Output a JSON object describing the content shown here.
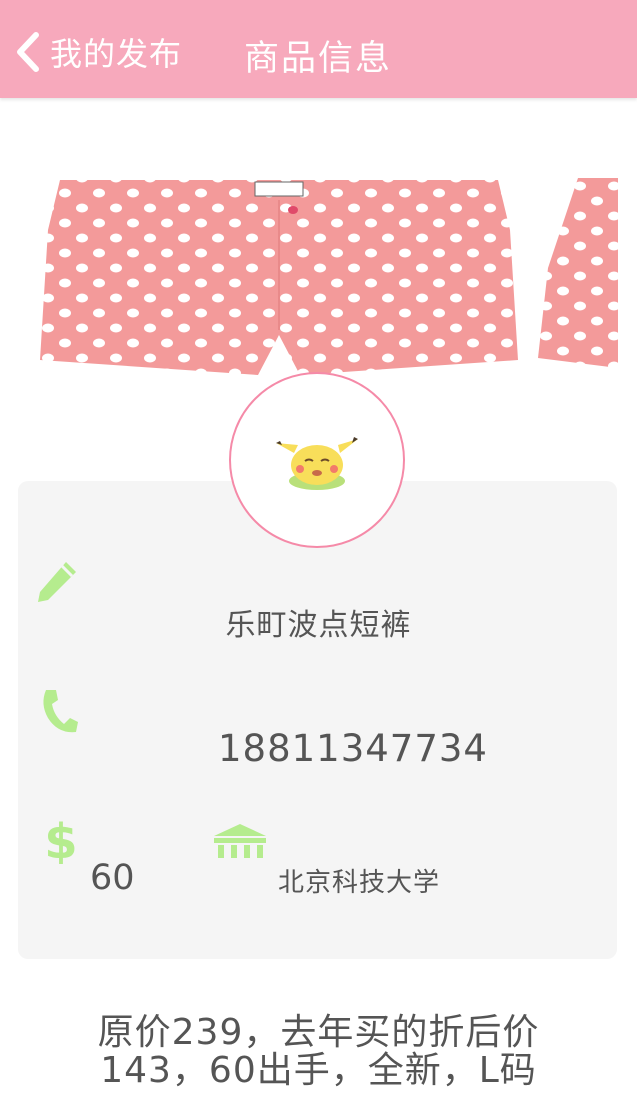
{
  "header": {
    "back_label": "我的发布",
    "title": "商品信息"
  },
  "product": {
    "name": "乐町波点短裤",
    "phone": "18811347734",
    "price": "60",
    "school": "北京科技大学",
    "description_line1": "原价239，去年买的折后价",
    "description_line2": "143，60出手，全新，L码"
  },
  "icons": {
    "back": "chevron-left-icon",
    "name": "pencil-icon",
    "phone": "phone-icon",
    "price": "dollar-icon",
    "school": "school-building-icon",
    "avatar": "pikachu-avatar"
  },
  "colors": {
    "header_bg": "#f7a9bc",
    "accent_pink": "#f58aa8",
    "icon_green": "#b5ec8e",
    "card_bg": "#f5f5f5",
    "text": "#555555"
  }
}
